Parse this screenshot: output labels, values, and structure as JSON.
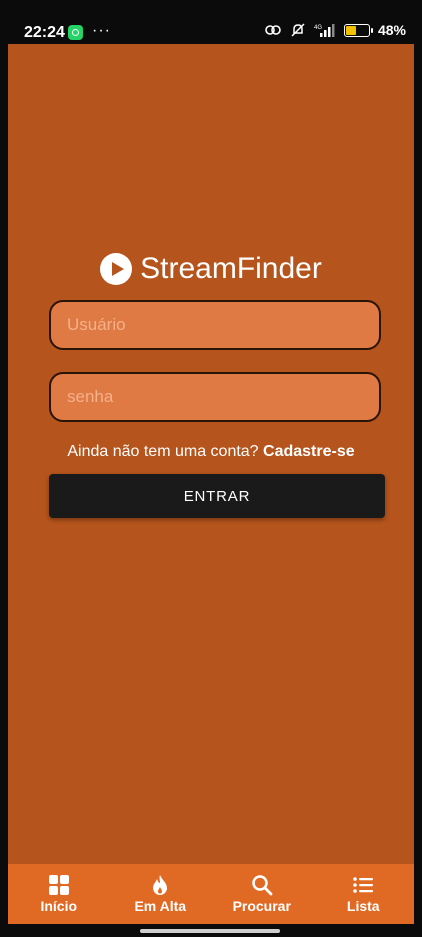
{
  "status_bar": {
    "time": "22:24",
    "dots": "···",
    "network": "4G",
    "battery_pct": "48%"
  },
  "app": {
    "name": "StreamFinder",
    "background": "#b5541c"
  },
  "login": {
    "username_placeholder": "Usuário",
    "username_value": "",
    "password_placeholder": "senha",
    "password_value": "",
    "signup_prompt": "Ainda não tem uma conta?",
    "signup_link": "Cadastre-se",
    "login_button": "ENTRAR"
  },
  "bottom_nav": {
    "items": [
      {
        "label": "Início",
        "icon": "grid-icon"
      },
      {
        "label": "Em Alta",
        "icon": "flame-icon"
      },
      {
        "label": "Procurar",
        "icon": "search-icon"
      },
      {
        "label": "Lista",
        "icon": "list-icon"
      }
    ]
  }
}
